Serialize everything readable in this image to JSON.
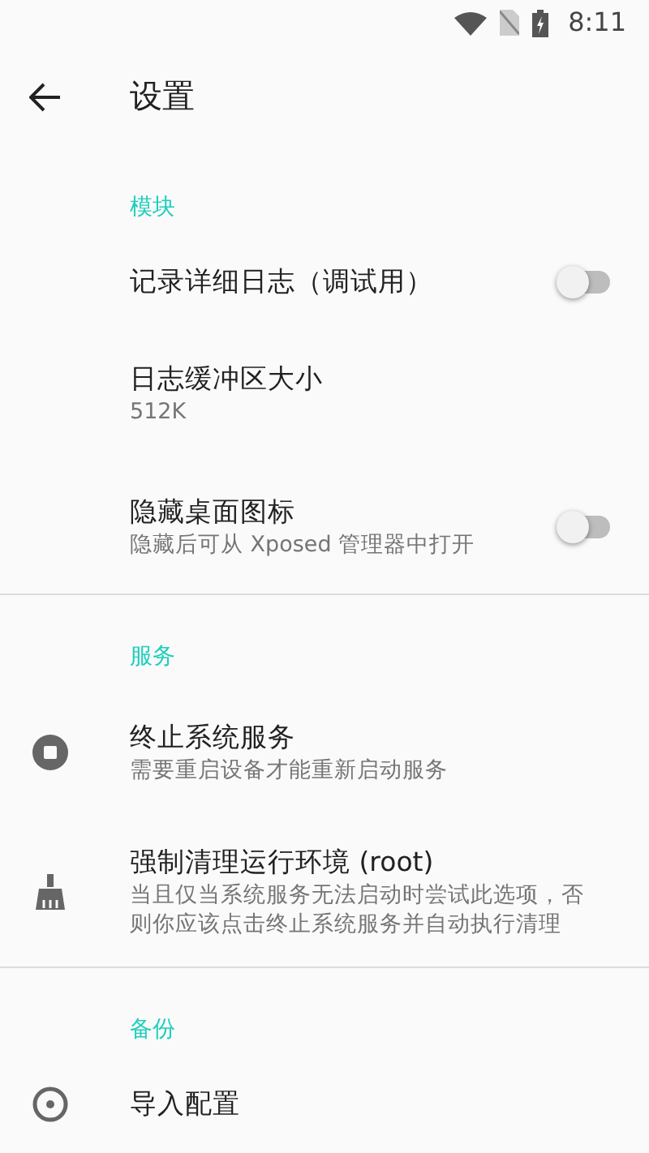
{
  "status_bar": {
    "time": "8:11"
  },
  "toolbar": {
    "title": "设置"
  },
  "sections": [
    {
      "title": "模块",
      "items": [
        {
          "kind": "switch",
          "title": "记录详细日志（调试用）",
          "on": false
        },
        {
          "kind": "text",
          "title": "日志缓冲区大小",
          "summary": "512K"
        },
        {
          "kind": "switch",
          "title": "隐藏桌面图标",
          "summary": "隐藏后可从 Xposed 管理器中打开",
          "on": false
        }
      ]
    },
    {
      "title": "服务",
      "items": [
        {
          "kind": "text",
          "title": "终止系统服务",
          "summary": "需要重启设备才能重新启动服务"
        },
        {
          "kind": "text",
          "title": "强制清理运行环境 (root)",
          "summary": "当且仅当系统服务无法启动时尝试此选项，否则你应该点击终止系统服务并自动执行清理"
        }
      ]
    },
    {
      "title": "备份",
      "items": [
        {
          "kind": "text",
          "title": "导入配置"
        }
      ]
    }
  ]
}
